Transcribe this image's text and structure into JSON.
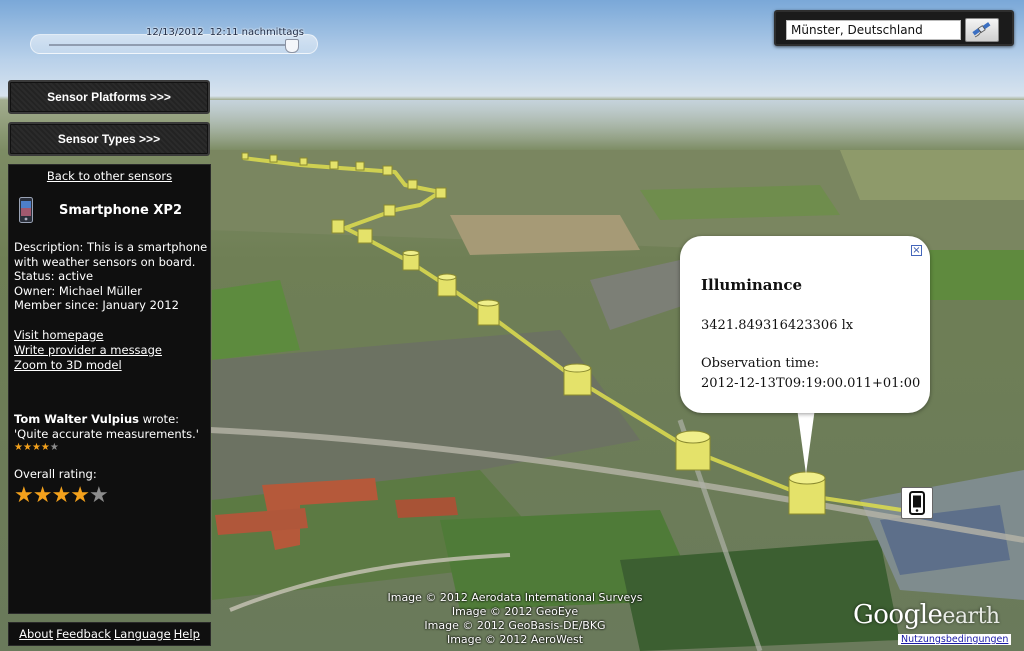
{
  "time_slider": {
    "date": "12/13/2012",
    "time": "12:11 nachmittags"
  },
  "search": {
    "value": "Münster, Deutschland",
    "button_icon": "satellite-icon"
  },
  "nav": {
    "platforms_label": "Sensor Platforms >>>",
    "types_label": "Sensor Types >>>"
  },
  "panel": {
    "back_link": "Back to other sensors",
    "device_icon": "smartphone-icon",
    "device_name": "Smartphone XP2",
    "description": "Description: This is a smartphone with weather sensors on board.",
    "status": "Status: active",
    "owner": "Owner: Michael Müller",
    "member_since": "Member since: January 2012",
    "links": [
      "Visit homepage",
      "Write provider a message",
      "Zoom to 3D model"
    ],
    "review": {
      "author": "Tom Walter Vulpius",
      "wrote": " wrote:",
      "text": "'Quite accurate measurements.'",
      "stars": 4,
      "max_stars": 5
    },
    "overall_rating_label": "Overall rating:",
    "overall_rating": 4,
    "overall_max": 5
  },
  "footer": {
    "links": [
      "About",
      "Feedback",
      "Language",
      "Help"
    ]
  },
  "popup": {
    "title": "Illuminance",
    "value": "3421.849316423306 lx",
    "time_label": "Observation time:",
    "time_value": "2012-12-13T09:19:00.011+01:00",
    "close_icon": "close-icon"
  },
  "marker_icon": "smartphone-icon",
  "credits": [
    "Image © 2012 Aerodata International Surveys",
    "Image © 2012 GeoEye",
    "Image © 2012 GeoBasis-DE/BKG",
    "Image © 2012 AeroWest"
  ],
  "logo": {
    "google": "Google",
    "earth": "earth"
  },
  "terms_link": "Nutzungsbedingungen",
  "colors": {
    "path": "#d8d850",
    "cylinder": "#e4e26a",
    "star_on": "#f3a11c",
    "star_off": "#8c8c8c"
  }
}
